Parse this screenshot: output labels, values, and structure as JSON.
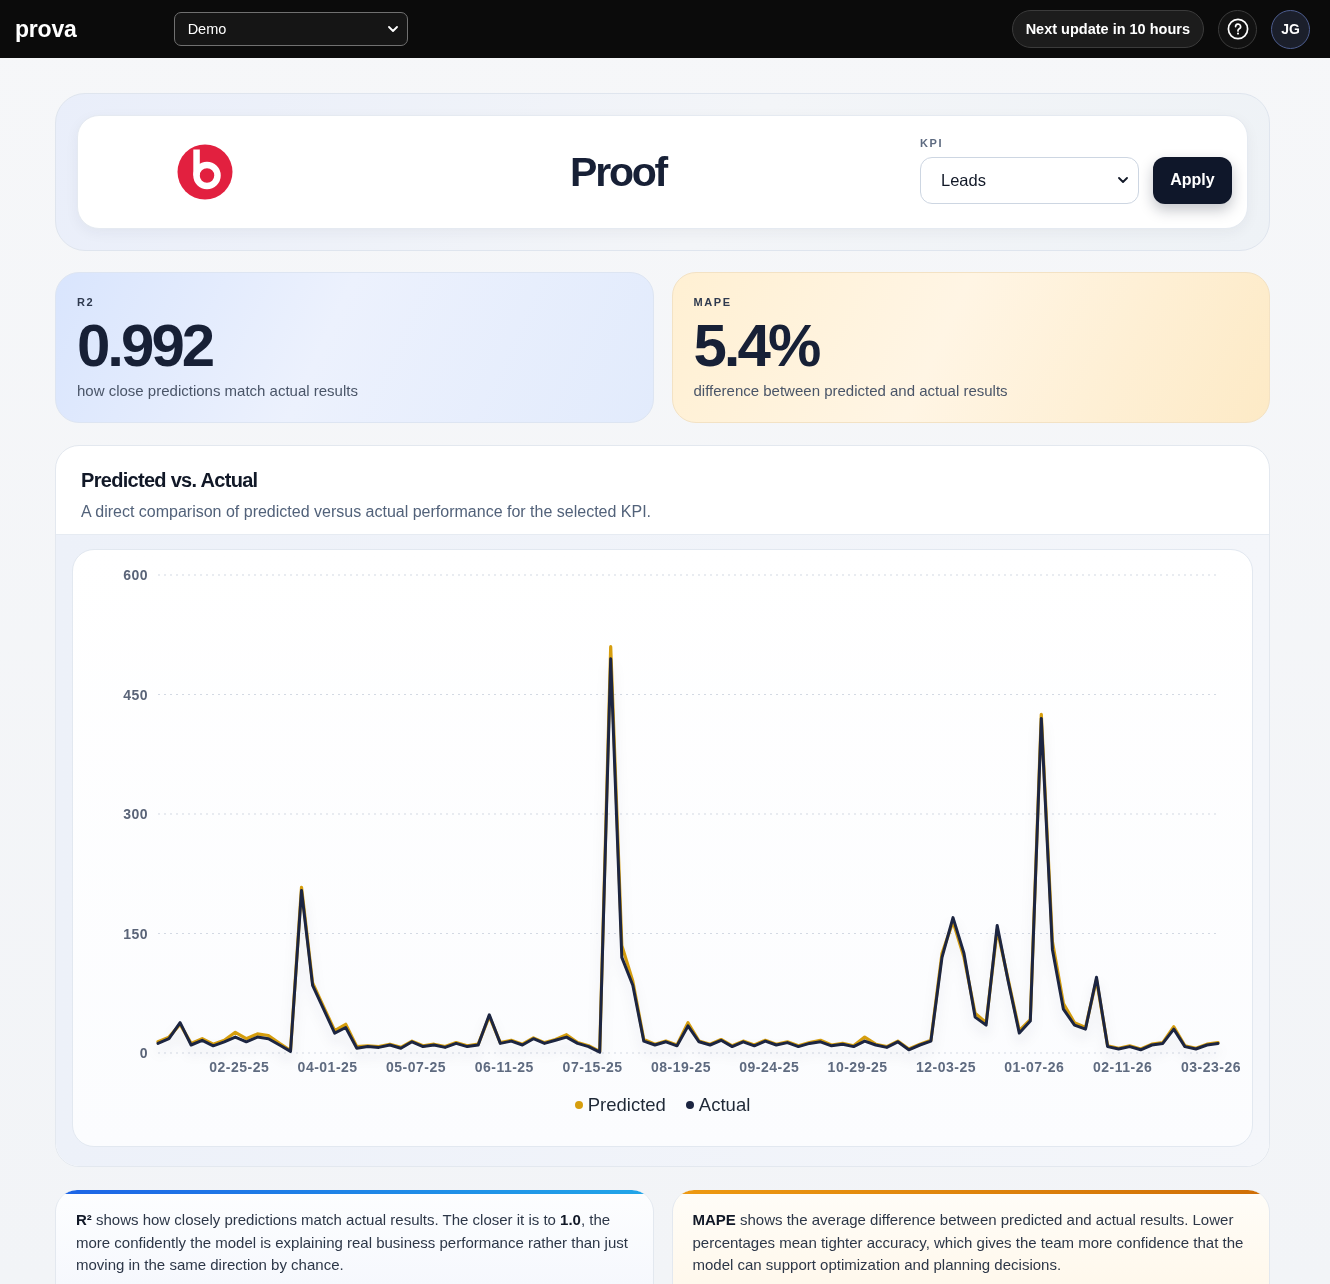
{
  "topbar": {
    "brand": "prova",
    "workspace_select": {
      "value": "Demo"
    },
    "update_button": "Next update in 10 hours",
    "avatar": "JG"
  },
  "header": {
    "title": "Proof",
    "kpi_select": {
      "label": "KPI",
      "value": "Leads"
    },
    "apply_button": "Apply"
  },
  "metrics": [
    {
      "label": "R2",
      "value": "0.992",
      "description": "how close predictions match actual results"
    },
    {
      "label": "MAPE",
      "value": "5.4%",
      "description": "difference between predicted and actual results"
    }
  ],
  "chart_card": {
    "title": "Predicted vs. Actual",
    "subtitle": "A direct comparison of predicted versus actual performance for the selected KPI.",
    "chart_data": {
      "type": "line",
      "grid": true,
      "legend": "bottom",
      "categories": [
        null,
        null,
        null,
        null,
        null,
        null,
        null,
        "02-25-25",
        null,
        null,
        null,
        null,
        null,
        null,
        null,
        "04-01-25",
        null,
        null,
        null,
        null,
        null,
        null,
        null,
        "05-07-25",
        null,
        null,
        null,
        null,
        null,
        null,
        null,
        "06-11-25",
        null,
        null,
        null,
        null,
        null,
        null,
        null,
        "07-15-25",
        null,
        null,
        null,
        null,
        null,
        null,
        null,
        "08-19-25",
        null,
        null,
        null,
        null,
        null,
        null,
        null,
        "09-24-25",
        null,
        null,
        null,
        null,
        null,
        null,
        null,
        "10-29-25",
        null,
        null,
        null,
        null,
        null,
        null,
        null,
        "12-03-25",
        null,
        null,
        null,
        null,
        null,
        null,
        null,
        "01-07-26",
        null,
        null,
        null,
        null,
        null,
        null,
        null,
        "02-11-26",
        null,
        null,
        null,
        null,
        null,
        null,
        null,
        "03-23-26",
        null
      ],
      "ylim": [
        0,
        600
      ],
      "yticks": [
        0,
        150,
        300,
        450,
        600
      ],
      "series": [
        {
          "name": "Predicted",
          "color": "#d69e0e",
          "values": [
            14,
            20,
            36,
            12,
            18,
            11,
            16,
            26,
            18,
            24,
            22,
            12,
            3,
            208,
            88,
            58,
            28,
            36,
            8,
            9,
            8,
            11,
            7,
            15,
            9,
            11,
            8,
            13,
            9,
            11,
            46,
            13,
            16,
            11,
            19,
            13,
            17,
            23,
            13,
            9,
            2,
            510,
            135,
            90,
            17,
            11,
            15,
            10,
            38,
            15,
            11,
            17,
            9,
            15,
            10,
            16,
            11,
            14,
            9,
            13,
            16,
            10,
            12,
            9,
            20,
            11,
            8,
            15,
            5,
            11,
            16,
            125,
            165,
            120,
            50,
            38,
            155,
            92,
            28,
            42,
            425,
            140,
            62,
            38,
            32,
            92,
            9,
            6,
            9,
            5,
            11,
            13,
            33,
            9,
            6,
            11,
            13
          ]
        },
        {
          "name": "Actual",
          "color": "#1c2541",
          "values": [
            12,
            18,
            38,
            10,
            16,
            9,
            14,
            20,
            14,
            20,
            18,
            10,
            2,
            204,
            85,
            55,
            25,
            32,
            6,
            8,
            7,
            10,
            6,
            14,
            8,
            10,
            7,
            12,
            8,
            10,
            48,
            12,
            15,
            10,
            18,
            12,
            16,
            20,
            12,
            8,
            1,
            495,
            120,
            85,
            15,
            10,
            14,
            9,
            34,
            14,
            10,
            16,
            8,
            14,
            9,
            15,
            10,
            13,
            8,
            12,
            14,
            9,
            11,
            8,
            15,
            10,
            7,
            14,
            4,
            10,
            15,
            120,
            170,
            125,
            45,
            35,
            160,
            90,
            25,
            40,
            420,
            130,
            55,
            35,
            30,
            95,
            8,
            5,
            8,
            4,
            10,
            12,
            30,
            8,
            5,
            10,
            12
          ]
        }
      ]
    }
  },
  "info_cards": [
    {
      "text": "**R²** shows how closely predictions match actual results. The closer it is to **1.0**, the more confidently the model is explaining real business performance rather than just moving in the same direction by chance."
    },
    {
      "text": "**MAPE** shows the average difference between predicted and actual results. Lower percentages mean tighter accuracy, which gives the team more confidence that the model can support optimization and planning decisions."
    }
  ]
}
